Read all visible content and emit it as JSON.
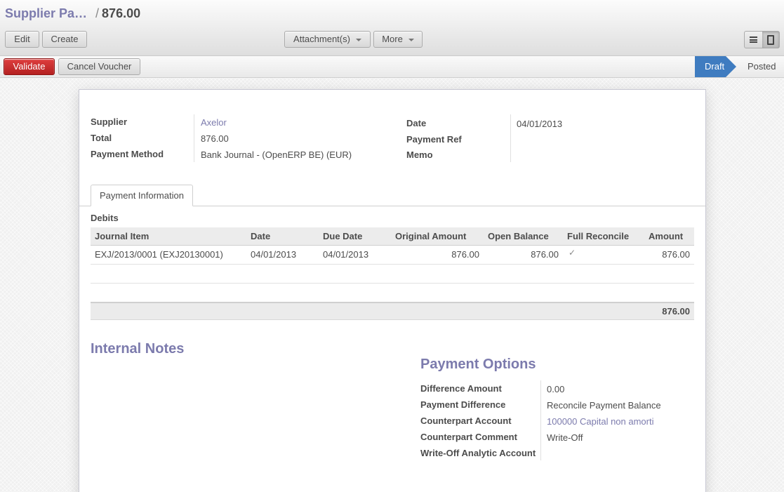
{
  "header": {
    "breadcrumb_parent": "Supplier Pa…",
    "breadcrumb_separator": "/",
    "breadcrumb_current": "876.00"
  },
  "toolbar": {
    "edit_label": "Edit",
    "create_label": "Create",
    "attachments_label": "Attachment(s)",
    "more_label": "More"
  },
  "statusbar": {
    "validate_label": "Validate",
    "cancel_label": "Cancel Voucher",
    "stages": [
      "Draft",
      "Posted"
    ],
    "active_stage": "Draft"
  },
  "form": {
    "supplier_label": "Supplier",
    "supplier_value": "Axelor",
    "total_label": "Total",
    "total_value": "876.00",
    "payment_method_label": "Payment Method",
    "payment_method_value": "Bank Journal - (OpenERP BE) (EUR)",
    "date_label": "Date",
    "date_value": "04/01/2013",
    "payment_ref_label": "Payment Ref",
    "payment_ref_value": "",
    "memo_label": "Memo",
    "memo_value": ""
  },
  "tabs": [
    {
      "label": "Payment Information",
      "active": true
    }
  ],
  "debits": {
    "title": "Debits",
    "columns": [
      "Journal Item",
      "Date",
      "Due Date",
      "Original Amount",
      "Open Balance",
      "Full Reconcile",
      "Amount"
    ],
    "rows": [
      {
        "journal_item": "EXJ/2013/0001 (EXJ20130001)",
        "date": "04/01/2013",
        "due_date": "04/01/2013",
        "original_amount": "876.00",
        "open_balance": "876.00",
        "full_reconcile": true,
        "amount": "876.00"
      }
    ],
    "total": "876.00"
  },
  "internal_notes": {
    "title": "Internal Notes"
  },
  "payment_options": {
    "title": "Payment Options",
    "fields": [
      {
        "label": "Difference Amount",
        "value": "0.00",
        "is_link": false
      },
      {
        "label": "Payment Difference",
        "value": "Reconcile Payment Balance",
        "is_link": false
      },
      {
        "label": "Counterpart Account",
        "value": "100000 Capital non amorti",
        "is_link": true
      },
      {
        "label": "Counterpart Comment",
        "value": "Write-Off",
        "is_link": false
      },
      {
        "label": "Write-Off Analytic Account",
        "value": "",
        "is_link": false
      }
    ]
  },
  "colors": {
    "accent": "#7c7bad",
    "validate": "#c62828",
    "active_stage": "#3f7cc0"
  }
}
